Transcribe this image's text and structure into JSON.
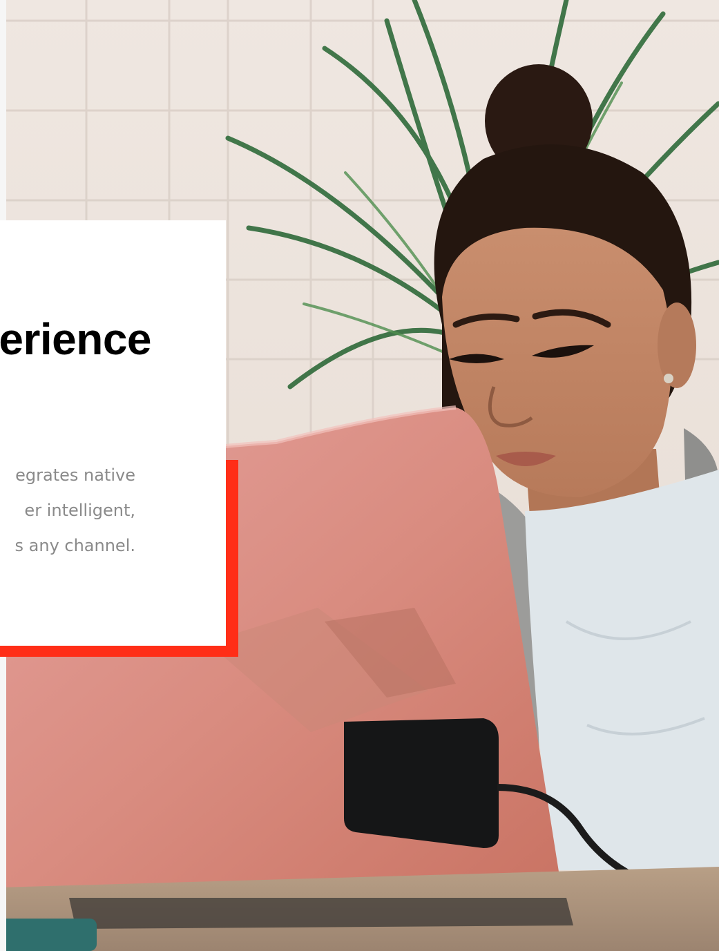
{
  "hero": {
    "photo_alt": "woman working on a pink laptop in front of a plant",
    "heading": "erience",
    "body_lines": [
      "egrates native",
      "er intelligent,",
      "s any channel."
    ]
  },
  "colors": {
    "accent": "#ff2e17",
    "card_background": "#ffffff",
    "heading_text": "#000000",
    "body_text": "#8a8a8a"
  },
  "icons": []
}
